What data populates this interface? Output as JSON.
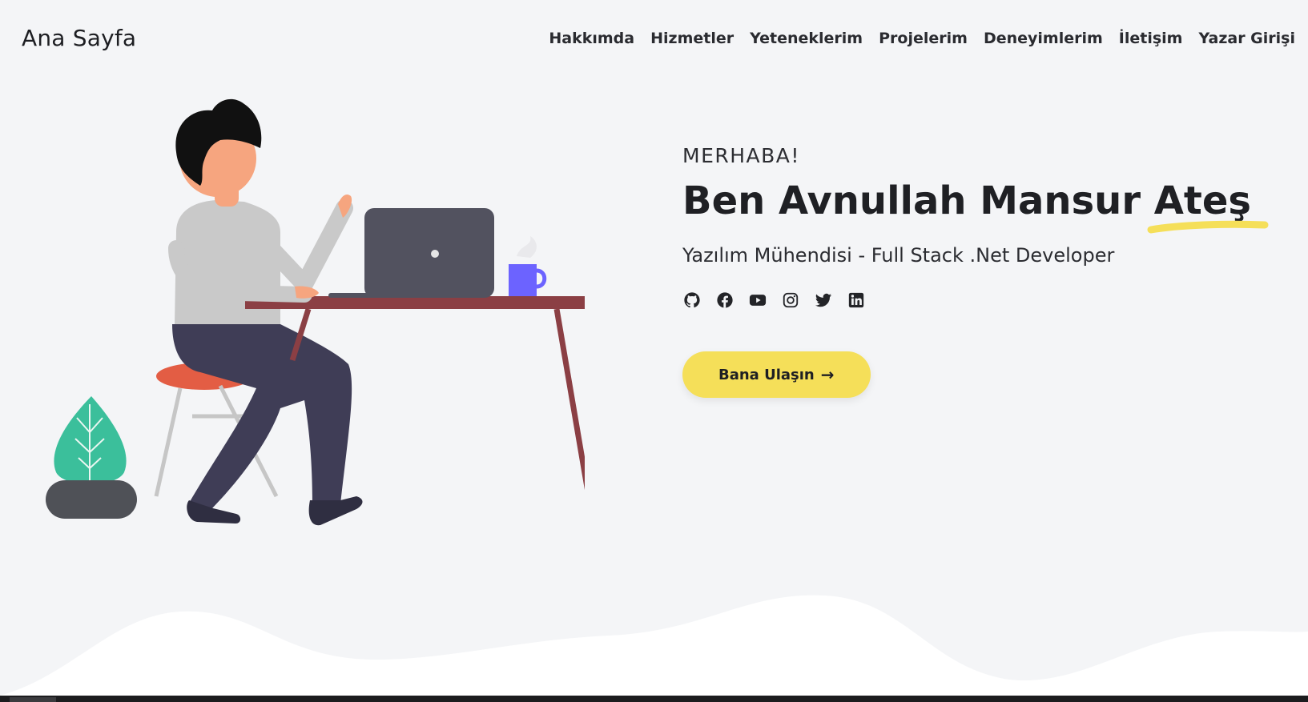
{
  "navbar": {
    "brand": "Ana Sayfa",
    "links": [
      "Hakkımda",
      "Hizmetler",
      "Yeteneklerim",
      "Projelerim",
      "Deneyimlerim",
      "İletişim",
      "Yazar Girişi"
    ]
  },
  "hero": {
    "greeting": "MERHABA!",
    "title_main": "Ben Avnullah Mansur ",
    "title_highlight": "Ateş",
    "subtitle": "Yazılım Mühendisi - Full Stack .Net Developer",
    "socials": [
      "github-icon",
      "facebook-icon",
      "youtube-icon",
      "instagram-icon",
      "twitter-icon",
      "linkedin-icon"
    ],
    "cta_label": "Bana Ulaşın",
    "cta_arrow": "→"
  },
  "colors": {
    "background": "#f4f5f7",
    "accent_yellow": "#f5df59",
    "text_dark": "#1f2024",
    "desk": "#8b3f44",
    "laptop": "#52525f",
    "mug": "#6c63ff",
    "leaf": "#3bbf9b"
  }
}
